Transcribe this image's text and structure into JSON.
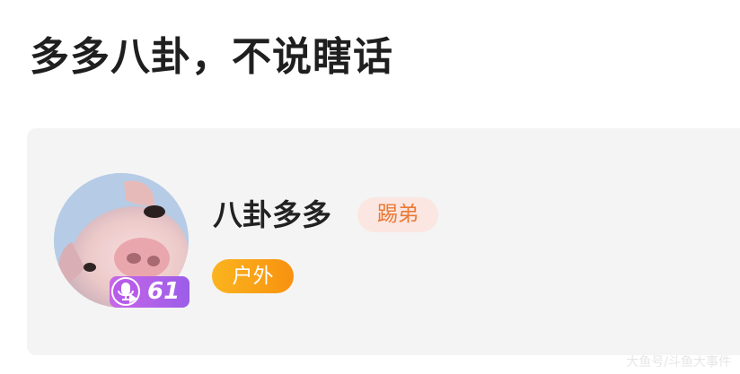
{
  "header": {
    "title": "多多八卦，不说瞎话"
  },
  "profile": {
    "avatar_icon": "pig-avatar",
    "level_icon": "microphone-icon",
    "level": "61",
    "username": "八卦多多",
    "role_badge": "踢弟",
    "category_tag": "户外"
  },
  "watermark": {
    "text": "大鱼号/斗鱼大事件"
  },
  "colors": {
    "card_background": "#f4f4f4",
    "role_badge_bg": "#fbe6e1",
    "role_badge_text": "#ea7a36",
    "category_gradient_start": "#fbb41f",
    "category_gradient_end": "#f8920f",
    "level_badge_start": "#c866e8",
    "level_badge_end": "#9b5de9"
  }
}
